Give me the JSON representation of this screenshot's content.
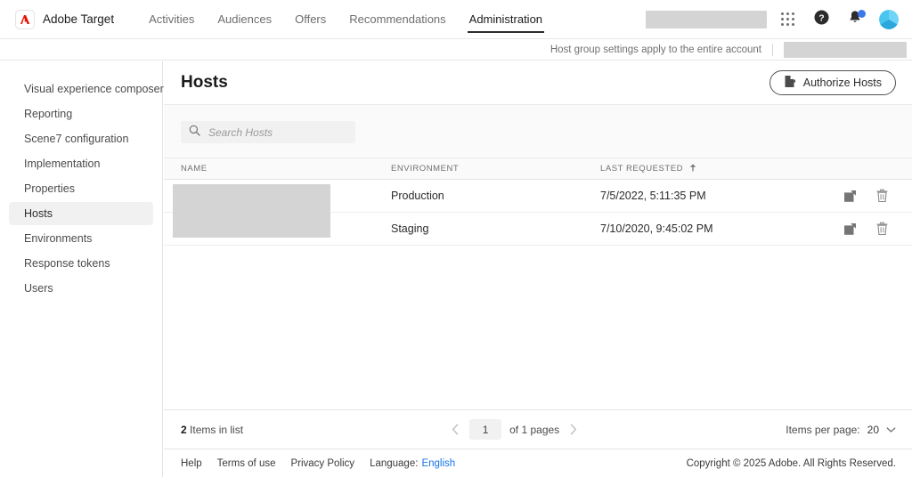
{
  "topnav": {
    "brand": "Adobe Target",
    "logo_icon": "adobe-logo-icon",
    "logo_color": "#eb1000",
    "tabs": [
      {
        "label": "Activities",
        "active": false
      },
      {
        "label": "Audiences",
        "active": false
      },
      {
        "label": "Offers",
        "active": false
      },
      {
        "label": "Recommendations",
        "active": false
      },
      {
        "label": "Administration",
        "active": true
      }
    ],
    "icons": {
      "apps": "app-grid-icon",
      "help": "help-icon",
      "notifications": "bell-icon",
      "avatar": "avatar-icon"
    },
    "notification_badge_color": "#3b79e8"
  },
  "subheader": {
    "notice": "Host group settings apply to the entire account"
  },
  "sidebar": {
    "items": [
      {
        "label": "Visual experience composer",
        "active": false
      },
      {
        "label": "Reporting",
        "active": false
      },
      {
        "label": "Scene7 configuration",
        "active": false
      },
      {
        "label": "Implementation",
        "active": false
      },
      {
        "label": "Properties",
        "active": false
      },
      {
        "label": "Hosts",
        "active": true
      },
      {
        "label": "Environments",
        "active": false
      },
      {
        "label": "Response tokens",
        "active": false
      },
      {
        "label": "Users",
        "active": false
      }
    ]
  },
  "page": {
    "title": "Hosts",
    "authorize_button": "Authorize Hosts",
    "authorize_icon": "document-page-icon"
  },
  "search": {
    "placeholder": "Search Hosts",
    "value": "",
    "icon": "search-icon"
  },
  "table": {
    "columns": [
      {
        "key": "name",
        "label": "NAME"
      },
      {
        "key": "environment",
        "label": "ENVIRONMENT"
      },
      {
        "key": "last_requested",
        "label": "LAST REQUESTED"
      },
      {
        "key": "actions",
        "label": ""
      }
    ],
    "sort": {
      "column": "LAST REQUESTED",
      "direction": "asc",
      "icon": "sort-arrow-up-icon"
    },
    "rows": [
      {
        "name": "",
        "environment": "Production",
        "last_requested": "7/5/2022, 5:11:35 PM"
      },
      {
        "name": "",
        "environment": "Staging",
        "last_requested": "7/10/2020, 9:45:02 PM"
      }
    ],
    "row_actions": [
      {
        "name": "edit-icon",
        "label": "Edit"
      },
      {
        "name": "delete-icon",
        "label": "Delete"
      }
    ]
  },
  "pagination": {
    "items_count": "2",
    "items_label": "Items in list",
    "prev_icon": "chevron-left-icon",
    "next_icon": "chevron-right-icon",
    "current_page": "1",
    "of_pages": "of 1 pages",
    "items_per_page_label": "Items per page:",
    "items_per_page_value": "20",
    "dropdown_icon": "chevron-down-icon"
  },
  "footer": {
    "help": "Help",
    "terms": "Terms of use",
    "privacy": "Privacy Policy",
    "language_label": "Language:",
    "language_value": "English",
    "copyright": "Copyright © 2025 Adobe. All Rights Reserved."
  }
}
